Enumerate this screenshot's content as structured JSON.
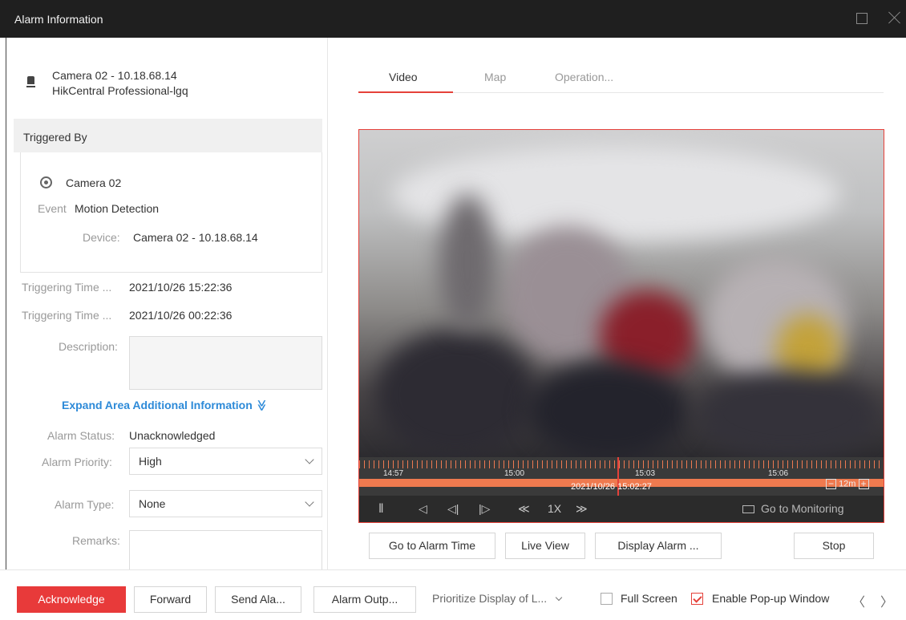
{
  "window": {
    "title": "Alarm Information"
  },
  "camera_header": {
    "name_ip": "Camera 02 - 10.18.68.14",
    "server": "HikCentral Professional-lgq"
  },
  "triggered_by": {
    "header": "Triggered By",
    "camera": "Camera 02",
    "event_label": "Event",
    "event_value": "Motion Detection",
    "device_label": "Device:",
    "device_value": "Camera 02 - 10.18.68.14"
  },
  "details": {
    "trig_time_1_label": "Triggering Time ...",
    "trig_time_1_value": "2021/10/26 15:22:36",
    "trig_time_2_label": "Triggering Time ...",
    "trig_time_2_value": "2021/10/26 00:22:36",
    "description_label": "Description:",
    "expand_label": "Expand Area Additional Information",
    "expand_chevron": "≫",
    "alarm_status_label": "Alarm Status:",
    "alarm_status_value": "Unacknowledged",
    "alarm_priority_label": "Alarm Priority:",
    "alarm_priority_value": "High",
    "alarm_type_label": "Alarm Type:",
    "alarm_type_value": "None",
    "remarks_label": "Remarks:"
  },
  "tabs": [
    {
      "label": "Video",
      "active": true
    },
    {
      "label": "Map",
      "active": false
    },
    {
      "label": "Operation...",
      "active": false
    }
  ],
  "player": {
    "timeline_labels": [
      "14:57",
      "15:00",
      "15:03",
      "15:06"
    ],
    "current_time": "2021/10/26 15:02:27",
    "zoom_minus": "−",
    "zoom_level": "12m",
    "zoom_plus": "+",
    "pause": "‖",
    "prev": "◁",
    "step_back": "◁|",
    "step_forward": "|▷",
    "slower": "≪",
    "speed": "1X",
    "faster": "≫",
    "go_to_monitoring": "Go to Monitoring"
  },
  "video_actions": {
    "go_to_alarm_time": "Go to Alarm Time",
    "live_view": "Live View",
    "display_alarm": "Display Alarm ...",
    "stop": "Stop"
  },
  "bottom": {
    "acknowledge": "Acknowledge",
    "forward": "Forward",
    "send_alarm": "Send Ala...",
    "alarm_output": "Alarm Outp...",
    "prioritize": "Prioritize Display of L...",
    "full_screen": "Full Screen",
    "full_screen_checked": false,
    "enable_popup": "Enable Pop-up Window",
    "enable_popup_checked": true,
    "prev_arrow": "〈",
    "next_arrow": "〉"
  },
  "colors": {
    "accent": "#e5413a",
    "link": "#2d8ad8",
    "acknowledge_bg": "#e83a3a",
    "timeline": "#ef7a4f"
  }
}
